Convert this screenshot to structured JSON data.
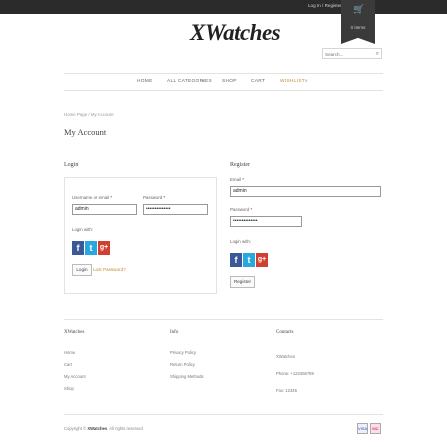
{
  "topbar": {
    "links": "Log In / Register"
  },
  "cart": {
    "icon": "cart-icon",
    "items": "0 items"
  },
  "logo": "XWatches",
  "search": {
    "placeholder": "Search...",
    "icon": "search-icon"
  },
  "nav": {
    "items": [
      "HOME",
      "ALL CATEGORIES",
      "SHOP",
      "CART",
      "WISHLIST"
    ],
    "chevron": "v"
  },
  "breadcrumb": "Home Page / My Account",
  "page_title": "My Account",
  "login": {
    "heading": "Login",
    "username_label": "Username or email",
    "username_value": "admin",
    "password_label": "Password",
    "password_value": "••••••••••••••",
    "login_with": "Login with:",
    "button": "Login",
    "lost_password": "Lost Password?"
  },
  "register": {
    "heading": "Register",
    "email_label": "Email",
    "email_value": "admin",
    "password_label": "Password",
    "password_value": "••••••••••••••",
    "login_with": "Login with:",
    "button": "Register"
  },
  "social": {
    "facebook": "f",
    "twitter": "t",
    "google": "g+"
  },
  "footer": {
    "col1": {
      "title": "XWatches",
      "items": [
        "Home",
        "Cart",
        "My Account",
        "Shop"
      ]
    },
    "col2": {
      "title": "Info",
      "items": [
        "Privacy Policy",
        "Return Policy",
        "Shipping Methods"
      ]
    },
    "col3": {
      "title": "Contacts",
      "items": [
        "XWatches",
        "Phone: +123456789",
        "Fax: 12345"
      ]
    },
    "copyright_prefix": "Copyright ©",
    "copyright_brand": "XWatches",
    "copyright_suffix": ". All rights reserved",
    "payments": [
      "VISA",
      "MC"
    ]
  },
  "colors": {
    "topbar": "#2b2b2b",
    "accent": "#c08a3a",
    "facebook": "#3b5998",
    "twitter": "#29a8e0",
    "google": "#d23f31"
  }
}
